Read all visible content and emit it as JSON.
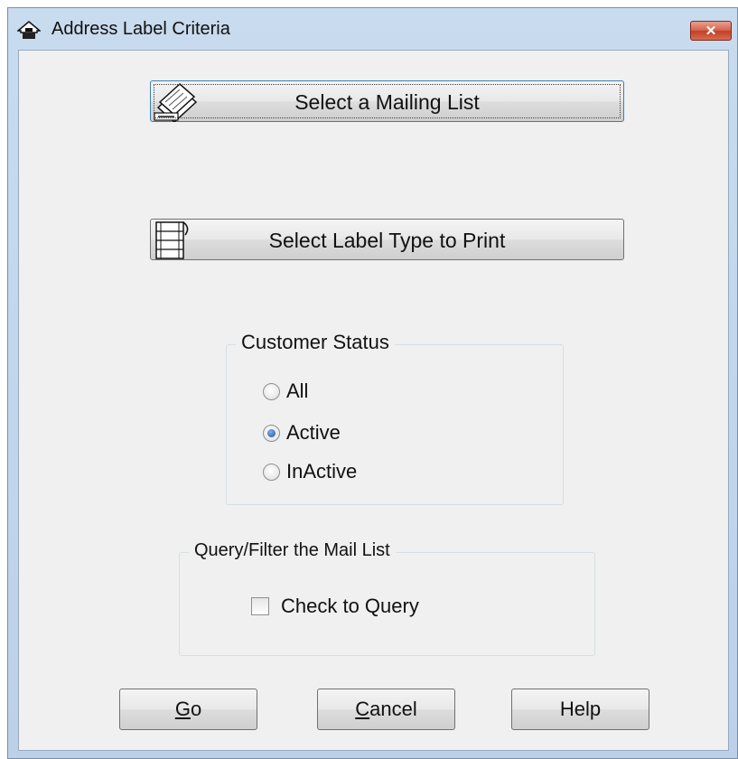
{
  "window": {
    "title": "Address Label Criteria",
    "close_glyph": "✕"
  },
  "buttons": {
    "mailing_list": "Select a Mailing List",
    "label_type": "Select Label Type to Print"
  },
  "customer_status": {
    "title": "Customer Status",
    "options": [
      {
        "label": "All",
        "checked": false
      },
      {
        "label": "Active",
        "checked": true
      },
      {
        "label": "InActive",
        "checked": false
      }
    ]
  },
  "query": {
    "title": "Query/Filter the Mail List",
    "checkbox_label": "Check to Query",
    "checked": false
  },
  "footer": {
    "go_mnemonic": "G",
    "go_rest": "o",
    "cancel_mnemonic": "C",
    "cancel_rest": "ancel",
    "help": "Help"
  },
  "icons": {
    "title": "home-printer-icon",
    "mailing_list": "mail-stack-icon",
    "label_type": "label-sheet-icon"
  }
}
